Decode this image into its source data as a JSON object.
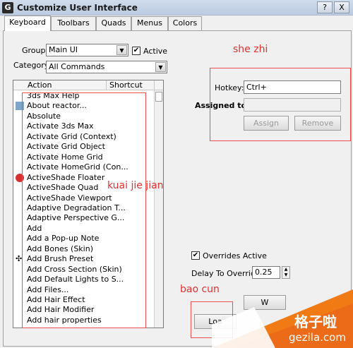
{
  "window": {
    "title": "Customize User Interface",
    "help_label": "?",
    "close_label": "X",
    "app_icon_glyph": "G"
  },
  "tabs": [
    "Keyboard",
    "Toolbars",
    "Quads",
    "Menus",
    "Colors"
  ],
  "group": {
    "label": "Group:",
    "value": "Main UI"
  },
  "active": {
    "label": "Active",
    "checked": true
  },
  "category": {
    "label": "Category:",
    "value": "All Commands"
  },
  "list": {
    "headers": [
      "Action",
      "Shortcut"
    ],
    "items": [
      {
        "label": "3ds Max Help",
        "icon": ""
      },
      {
        "label": "About reactor...",
        "icon": "reactor-icon"
      },
      {
        "label": "Absolute",
        "icon": ""
      },
      {
        "label": "Activate 3ds Max",
        "icon": ""
      },
      {
        "label": "Activate Grid (Context)",
        "icon": ""
      },
      {
        "label": "Activate Grid Object",
        "icon": ""
      },
      {
        "label": "Activate Home Grid",
        "icon": ""
      },
      {
        "label": "Activate HomeGrid (Con...",
        "icon": ""
      },
      {
        "label": "ActiveShade Floater",
        "icon": "activeshade-icon"
      },
      {
        "label": "ActiveShade Quad",
        "icon": ""
      },
      {
        "label": "ActiveShade Viewport",
        "icon": ""
      },
      {
        "label": "Adaptive Degradation T...",
        "icon": ""
      },
      {
        "label": "Adaptive Perspective G...",
        "icon": ""
      },
      {
        "label": "Add",
        "icon": ""
      },
      {
        "label": "Add a Pop-up Note",
        "icon": ""
      },
      {
        "label": "Add Bones (Skin)",
        "icon": ""
      },
      {
        "label": "Add Brush Preset",
        "icon": "brush-preset-icon"
      },
      {
        "label": "Add Cross Section (Skin)",
        "icon": ""
      },
      {
        "label": "Add Default Lights to S...",
        "icon": ""
      },
      {
        "label": "Add Files...",
        "icon": ""
      },
      {
        "label": "Add Hair Effect",
        "icon": ""
      },
      {
        "label": "Add Hair Modifier",
        "icon": ""
      },
      {
        "label": "Add hair properties",
        "icon": ""
      }
    ]
  },
  "hotkey": {
    "label": "Hotkey:",
    "value": "Ctrl+"
  },
  "assigned": {
    "label": "Assigned to:",
    "value": ""
  },
  "buttons": {
    "assign": "Assign",
    "remove": "Remove",
    "load": "Loa",
    "partial": "W"
  },
  "overrides": {
    "label": "Overrides Active",
    "checked": true
  },
  "delay": {
    "label": "Delay To Override:",
    "value": "0.25"
  },
  "annotations": {
    "top": "she zhi",
    "middle": "kuai  jie jian",
    "bottom": "bao  cun"
  },
  "watermark": {
    "main": "格子啦",
    "sub": "gezila.com"
  },
  "colors": {
    "annotation": "#e53030",
    "watermark_orange": "#f07a14"
  }
}
